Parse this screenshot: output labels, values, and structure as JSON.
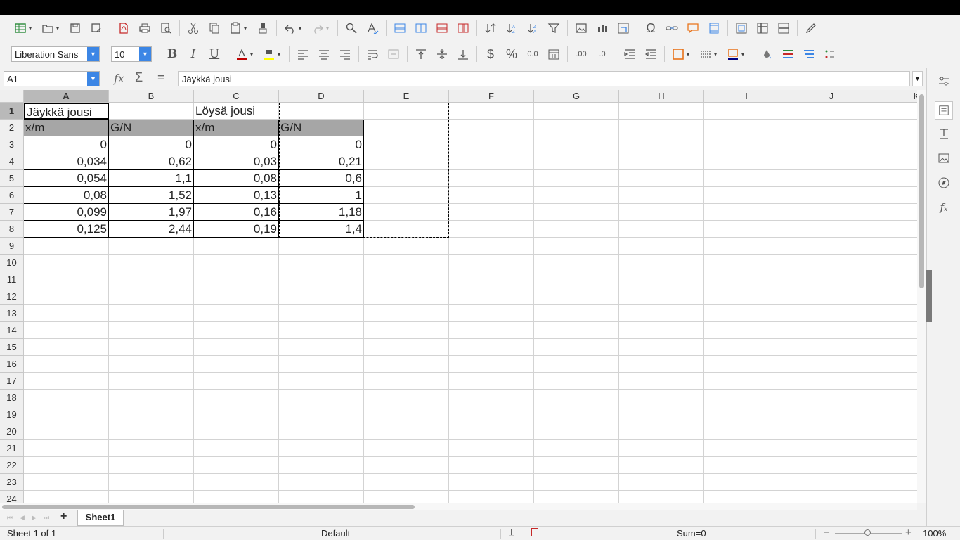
{
  "toolbar2": {
    "font_name": "Liberation Sans",
    "font_size": "10",
    "bold_label": "B",
    "italic_label": "I",
    "underline_label": "U",
    "currency_label": "$",
    "percent_label": "%",
    "number_label": "0.0",
    "add_decimal_label": ".00",
    "del_decimal_label": ".0",
    "font_color": "#c00000",
    "highlight_color": "#ffff00",
    "border_color": "#e8731a",
    "bg_color": "#000080"
  },
  "formula_bar": {
    "cell_ref": "A1",
    "content": "Jäykkä jousi",
    "fx": "fx",
    "sum": "Σ",
    "eq": "="
  },
  "columns": [
    "A",
    "B",
    "C",
    "D",
    "E",
    "F",
    "G",
    "H",
    "I",
    "J",
    "K"
  ],
  "rows": [
    "1",
    "2",
    "3",
    "4",
    "5",
    "6",
    "7",
    "8",
    "9",
    "10",
    "11",
    "12",
    "13",
    "14",
    "15",
    "16",
    "17",
    "18",
    "19",
    "20",
    "21",
    "22",
    "23",
    "24"
  ],
  "cells": {
    "A1": "Jäykkä jousi",
    "C1": "Löysä jousi",
    "A2": "x/m",
    "B2": "G/N",
    "C2": "x/m",
    "D2": "G/N",
    "A3": "0",
    "B3": "0",
    "C3": "0",
    "D3": "0",
    "A4": "0,034",
    "B4": "0,62",
    "C4": "0,03",
    "D4": "0,21",
    "A5": "0,054",
    "B5": "1,1",
    "C5": "0,08",
    "D5": "0,6",
    "A6": "0,08",
    "B6": "1,52",
    "C6": "0,13",
    "D6": "1",
    "A7": "0,099",
    "B7": "1,97",
    "C7": "0,16",
    "D7": "1,18",
    "A8": "0,125",
    "B8": "2,44",
    "C8": "0,19",
    "D8": "1,4"
  },
  "sheet_tabs": [
    "Sheet1"
  ],
  "status": {
    "sheet_info": "Sheet 1 of 1",
    "page_style": "Default",
    "sum": "Sum=0",
    "zoom": "100%"
  }
}
